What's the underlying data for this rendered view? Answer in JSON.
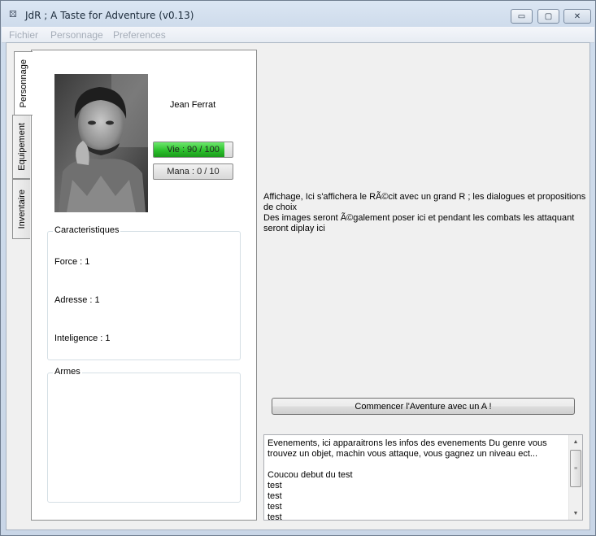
{
  "window": {
    "title": "JdR ; A Taste for Adventure (v0.13)",
    "minimize_glyph": "▭",
    "maximize_glyph": "▢",
    "close_glyph": "✕"
  },
  "menu": {
    "items": [
      "Fichier",
      "Personnage",
      "Preferences"
    ]
  },
  "tabs": [
    "Personnage",
    "Equipement",
    "Inventaire"
  ],
  "character": {
    "name": "Jean Ferrat",
    "health": {
      "label": "Vie : 90 / 100",
      "value": 90,
      "max": 100
    },
    "mana": {
      "label": "Mana : 0 / 10",
      "value": 0,
      "max": 10
    }
  },
  "stats": {
    "title": "Caracteristiques",
    "items": [
      "Force : 1",
      "Adresse : 1",
      "Inteligence : 1"
    ]
  },
  "weapons": {
    "title": "Armes"
  },
  "display": {
    "lines": [
      "Affichage, Ici s'affichera le RÃ©cit avec un grand R ; les dialogues et propositions de choix",
      "Des images seront Ã©galement poser ici et pendant les combats les attaquant seront diplay ici"
    ]
  },
  "start_button": "Commencer l'Aventure avec un A !",
  "log": {
    "lines": [
      "Evenements, ici apparaitrons les infos des evenements Du genre vous trouvez un objet, machin vous attaque, vous gagnez un niveau ect...",
      "",
      "Coucou debut du test",
      "test",
      "test",
      "test",
      "test"
    ]
  },
  "colors": {
    "health_fill": "#2cc02c"
  },
  "icons": {
    "app": "dice-icon",
    "scroll_up": "chevron-up-icon",
    "scroll_down": "chevron-down-icon"
  }
}
